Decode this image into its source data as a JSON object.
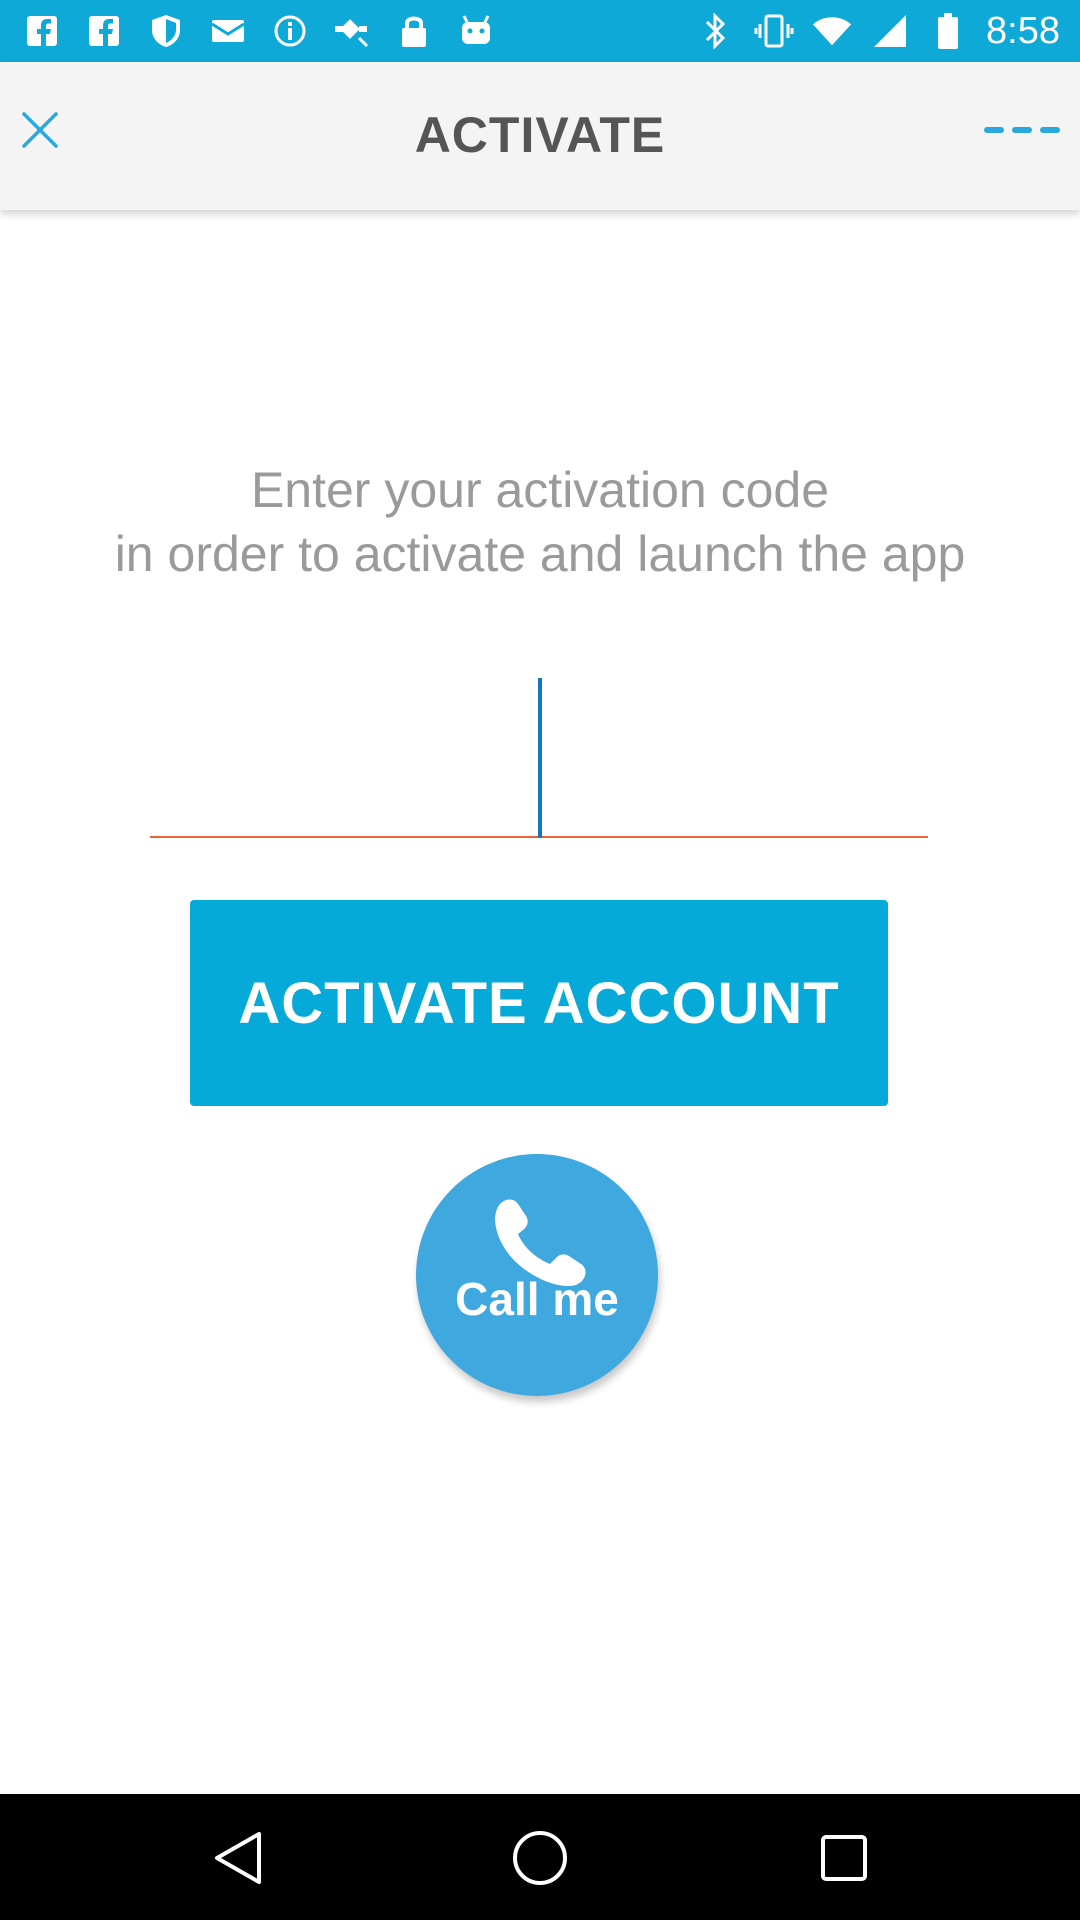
{
  "status_bar": {
    "time": "8:58",
    "left_icons": [
      "facebook-icon",
      "facebook-icon",
      "shield-icon",
      "mail-icon",
      "info-icon",
      "satellite-icon",
      "lock-icon",
      "android-icon"
    ],
    "right_icons": [
      "bluetooth-icon",
      "vibrate-icon",
      "wifi-icon",
      "signal-icon",
      "battery-icon"
    ],
    "color": "#0ea9d7"
  },
  "app_bar": {
    "title": "ACTIVATE",
    "close_icon": "close-icon",
    "menu_icon": "menu-dots-icon",
    "accent": "#29a8df"
  },
  "instruction": {
    "line1": "Enter your activation code",
    "line2": "in order to activate and launch the app"
  },
  "code_input": {
    "value": "",
    "underline_color": "#e8663a"
  },
  "activate_button": {
    "label": "ACTIVATE ACCOUNT",
    "color": "#06aad8"
  },
  "call_button": {
    "label": "Call me",
    "icon": "phone-icon",
    "color": "#3fa8de"
  },
  "nav_bar": {
    "buttons": [
      "back-icon",
      "home-icon",
      "recents-icon"
    ]
  }
}
